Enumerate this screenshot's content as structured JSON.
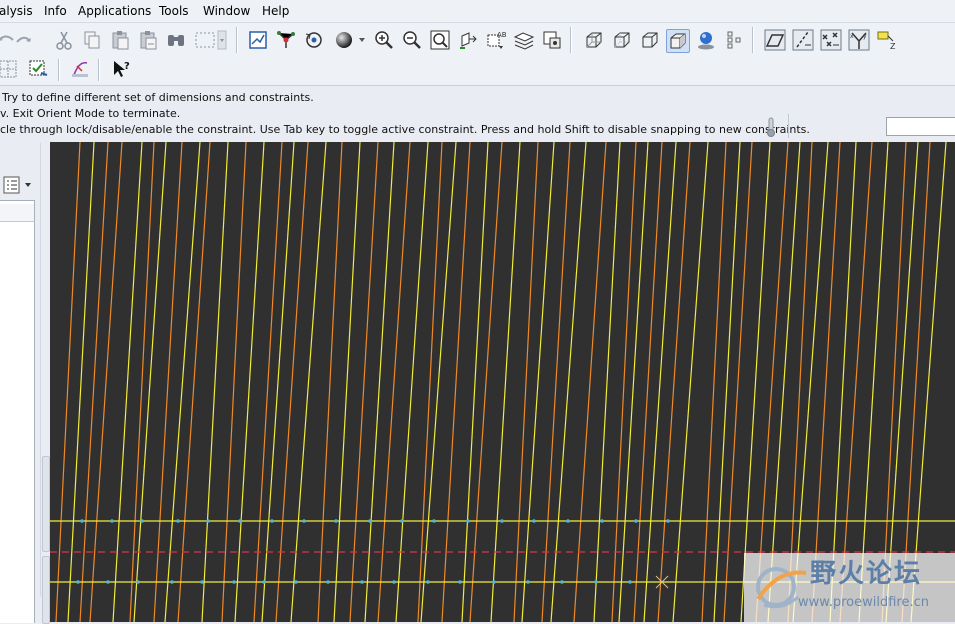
{
  "menubar": {
    "items": [
      "alysis",
      "Info",
      "Applications",
      "Tools",
      "Window",
      "Help"
    ]
  },
  "messages": [
    "Try to define different set of dimensions and constraints.",
    "v.  Exit Orient Mode to terminate.",
    "cle through lock/disable/enable the constraint. Use Tab key to toggle active constraint. Press and hold Shift to disable snapping to new constraints."
  ],
  "filter_input": {
    "value": ""
  },
  "watermark": {
    "title": "野火论坛",
    "url": "www.proewildfire.cn"
  },
  "colors": {
    "canvas_bg": "#303030",
    "curve_orange": "#f08a28",
    "curve_yellow": "#f2ec3a",
    "centerline": "#d8344a",
    "vertex_dot": "#4fb6d8",
    "active_toggle": "#cfe0f7"
  }
}
